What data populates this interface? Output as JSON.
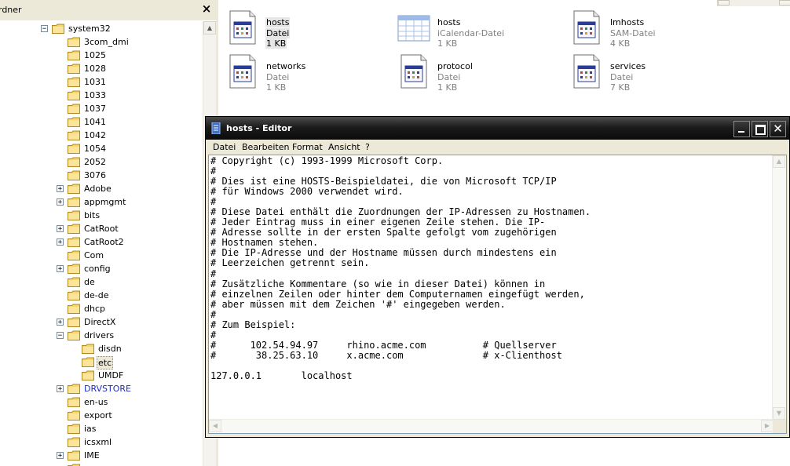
{
  "tree_pane": {
    "title": "rdner",
    "close_glyph": "×",
    "items": [
      {
        "label": "system32",
        "expander": "−",
        "level": 1
      },
      {
        "label": "3com_dmi",
        "expander": "",
        "level": 2
      },
      {
        "label": "1025",
        "expander": "",
        "level": 2
      },
      {
        "label": "1028",
        "expander": "",
        "level": 2
      },
      {
        "label": "1031",
        "expander": "",
        "level": 2
      },
      {
        "label": "1033",
        "expander": "",
        "level": 2
      },
      {
        "label": "1037",
        "expander": "",
        "level": 2
      },
      {
        "label": "1041",
        "expander": "",
        "level": 2
      },
      {
        "label": "1042",
        "expander": "",
        "level": 2
      },
      {
        "label": "1054",
        "expander": "",
        "level": 2
      },
      {
        "label": "2052",
        "expander": "",
        "level": 2
      },
      {
        "label": "3076",
        "expander": "",
        "level": 2
      },
      {
        "label": "Adobe",
        "expander": "+",
        "level": 2
      },
      {
        "label": "appmgmt",
        "expander": "+",
        "level": 2
      },
      {
        "label": "bits",
        "expander": "",
        "level": 2
      },
      {
        "label": "CatRoot",
        "expander": "+",
        "level": 2
      },
      {
        "label": "CatRoot2",
        "expander": "+",
        "level": 2
      },
      {
        "label": "Com",
        "expander": "",
        "level": 2
      },
      {
        "label": "config",
        "expander": "+",
        "level": 2
      },
      {
        "label": "de",
        "expander": "",
        "level": 2
      },
      {
        "label": "de-de",
        "expander": "",
        "level": 2
      },
      {
        "label": "dhcp",
        "expander": "",
        "level": 2
      },
      {
        "label": "DirectX",
        "expander": "+",
        "level": 2
      },
      {
        "label": "drivers",
        "expander": "−",
        "level": 2
      },
      {
        "label": "disdn",
        "expander": "",
        "level": 3
      },
      {
        "label": "etc",
        "expander": "",
        "level": 3,
        "selected": true
      },
      {
        "label": "UMDF",
        "expander": "",
        "level": 3
      },
      {
        "label": "DRVSTORE",
        "expander": "+",
        "level": 2,
        "blue": true
      },
      {
        "label": "en-us",
        "expander": "",
        "level": 2
      },
      {
        "label": "export",
        "expander": "",
        "level": 2
      },
      {
        "label": "ias",
        "expander": "",
        "level": 2
      },
      {
        "label": "icsxml",
        "expander": "",
        "level": 2
      },
      {
        "label": "IME",
        "expander": "+",
        "level": 2
      },
      {
        "label": "",
        "expander": "",
        "level": 2
      }
    ]
  },
  "files": [
    {
      "name": "hosts",
      "type": "Datei",
      "size": "1 KB",
      "icon": "text-document-icon",
      "selected": true
    },
    {
      "name": "hosts",
      "type": "iCalendar-Datei",
      "size": "1 KB",
      "icon": "calendar-icon"
    },
    {
      "name": "lmhosts",
      "type": "SAM-Datei",
      "size": "4 KB",
      "icon": "text-document-icon"
    },
    {
      "name": "networks",
      "type": "Datei",
      "size": "1 KB",
      "icon": "text-document-icon"
    },
    {
      "name": "protocol",
      "type": "Datei",
      "size": "1 KB",
      "icon": "text-document-icon"
    },
    {
      "name": "services",
      "type": "Datei",
      "size": "7 KB",
      "icon": "text-document-icon"
    }
  ],
  "notepad": {
    "title": "hosts - Editor",
    "close_glyph": "✕",
    "menu": [
      "Datei",
      "Bearbeiten",
      "Format",
      "Ansicht",
      "?"
    ],
    "content": "# Copyright (c) 1993-1999 Microsoft Corp.\n#\n# Dies ist eine HOSTS-Beispieldatei, die von Microsoft TCP/IP\n# für Windows 2000 verwendet wird.\n#\n# Diese Datei enthält die Zuordnungen der IP-Adressen zu Hostnamen.\n# Jeder Eintrag muss in einer eigenen Zeile stehen. Die IP-\n# Adresse sollte in der ersten Spalte gefolgt vom zugehörigen\n# Hostnamen stehen.\n# Die IP-Adresse und der Hostname müssen durch mindestens ein\n# Leerzeichen getrennt sein.\n#\n# Zusätzliche Kommentare (so wie in dieser Datei) können in\n# einzelnen Zeilen oder hinter dem Computernamen eingefügt werden,\n# aber müssen mit dem Zeichen '#' eingegeben werden.\n#\n# Zum Beispiel:\n#\n#      102.54.94.97     rhino.acme.com          # Quellserver\n#       38.25.63.10     x.acme.com              # x-Clienthost\n\n127.0.0.1       localhost"
  },
  "colors": {
    "folder": "#f5d76e",
    "selection": "#ece9d8",
    "title_bar": "#1c1c1c",
    "link_blue": "#1c2ecc"
  }
}
